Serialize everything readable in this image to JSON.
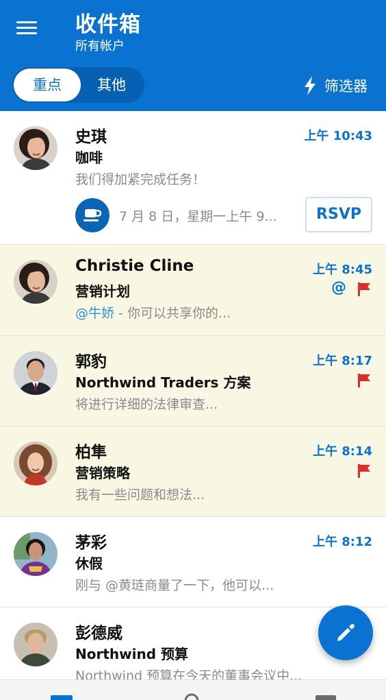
{
  "header": {
    "title": "收件箱",
    "subtitle": "所有帐户",
    "tabs": [
      {
        "label": "重点",
        "active": true
      },
      {
        "label": "其他",
        "active": false
      }
    ],
    "filter_label": "筛选器"
  },
  "messages": [
    {
      "sender": "史琪",
      "subject": "咖啡",
      "preview": "我们得加紧完成任务！",
      "time": "上午 10:43",
      "event_text": "7 月 8 日，星期一上午 9...",
      "rsvp_label": "RSVP",
      "focused": false
    },
    {
      "sender": "Christie Cline",
      "subject": "营销计划",
      "mention": "@牛娇",
      "preview": " - 你可以共享你的...",
      "time": "上午 8:45",
      "at_icon": "@",
      "flagged": true,
      "focused": true
    },
    {
      "sender": "郭豹",
      "subject": "Northwind Traders 方案",
      "preview": "将进行详细的法律审查...",
      "time": "上午 8:17",
      "flagged": true,
      "focused": true
    },
    {
      "sender": "柏隼",
      "subject": "营销策略",
      "preview": "我有一些问题和想法...",
      "time": "上午 8:14",
      "flagged": true,
      "focused": true
    },
    {
      "sender": "茅彩",
      "subject": "休假",
      "preview": "刚与 @黄琏商量了一下，他可以...",
      "time": "上午 8:12",
      "focused": false
    },
    {
      "sender": "彭德威",
      "subject": "Northwind 预算",
      "preview": "Northwind 预算在今天的董事会议中...",
      "time": "",
      "focused": false
    }
  ],
  "colors": {
    "brand": "#0a72d1",
    "focused_bg": "#f8f7e3",
    "flag": "#e02b2b"
  },
  "icons": {
    "menu": "hamburger-icon",
    "filter": "lightning-icon",
    "event": "coffee-cup-icon",
    "flag": "flag-icon",
    "compose": "pencil-icon",
    "nav": [
      "mail-icon",
      "search-icon",
      "calendar-icon"
    ]
  }
}
